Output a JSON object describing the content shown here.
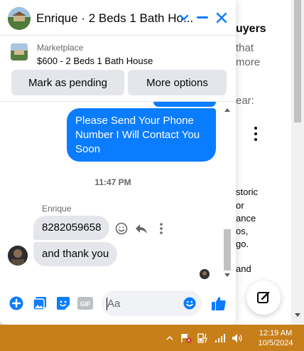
{
  "background": {
    "title_fragment": "uyers",
    "lines": [
      "that",
      "more",
      "ear:"
    ],
    "body_lines": [
      "storic",
      "or",
      "ance",
      "os,",
      "go.",
      "and"
    ]
  },
  "chat": {
    "title": "Enrique · 2 Beds 1 Bath Ho...",
    "marketplace_label": "Marketplace",
    "listing": "$600 - 2 Beds 1 Bath House",
    "mark_pending_label": "Mark as pending",
    "more_options_label": "More options",
    "outgoing_message": "Please Send Your Phone Number I Will Contact You Soon",
    "timestamp": "11:47 PM",
    "sender_name": "Enrique",
    "incoming_messages": [
      "8282059658",
      "and thank you"
    ],
    "composer_placeholder": "Aa",
    "gif_label": "GIF"
  },
  "taskbar": {
    "time": "12:19 AM",
    "date": "10/5/2024"
  },
  "colors": {
    "messenger_blue": "#0a7cff",
    "bubble_gray": "#e4e6eb",
    "taskbar": "#c77f1a"
  }
}
